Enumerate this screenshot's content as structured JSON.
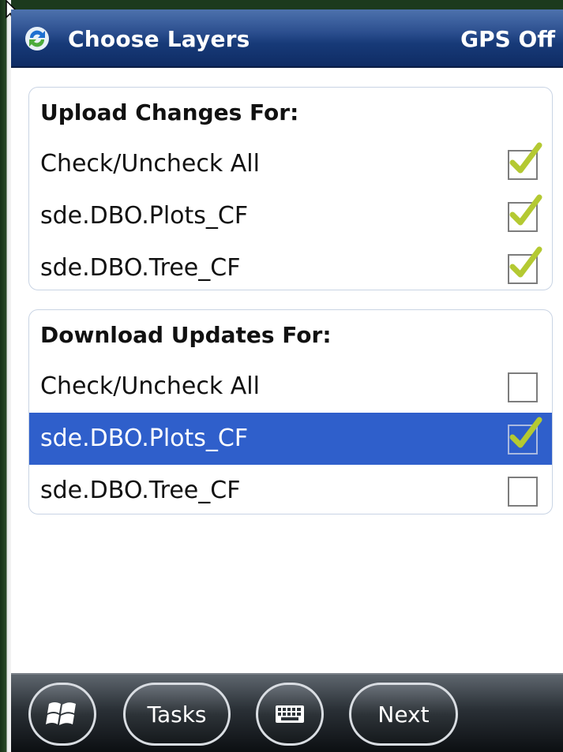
{
  "titlebar": {
    "title": "Choose Layers",
    "gps_status": "GPS Off",
    "icon": "sync-icon"
  },
  "upload_group": {
    "header": "Upload Changes For:",
    "rows": [
      {
        "label": "Check/Uncheck All",
        "checked": true
      },
      {
        "label": "sde.DBO.Plots_CF",
        "checked": true
      },
      {
        "label": "sde.DBO.Tree_CF",
        "checked": true
      }
    ]
  },
  "download_group": {
    "header": "Download Updates For:",
    "rows": [
      {
        "label": "Check/Uncheck All",
        "checked": false
      },
      {
        "label": "sde.DBO.Plots_CF",
        "checked": true,
        "selected": true
      },
      {
        "label": "sde.DBO.Tree_CF",
        "checked": false
      }
    ]
  },
  "taskbar": {
    "start_icon": "windows-logo-icon",
    "tasks_label": "Tasks",
    "keyboard_icon": "keyboard-icon",
    "next_label": "Next"
  },
  "colors": {
    "title_bar": "#173a78",
    "selection": "#2f5fcb",
    "check_mark": "#b4c932",
    "taskbar": "#2a3036"
  }
}
